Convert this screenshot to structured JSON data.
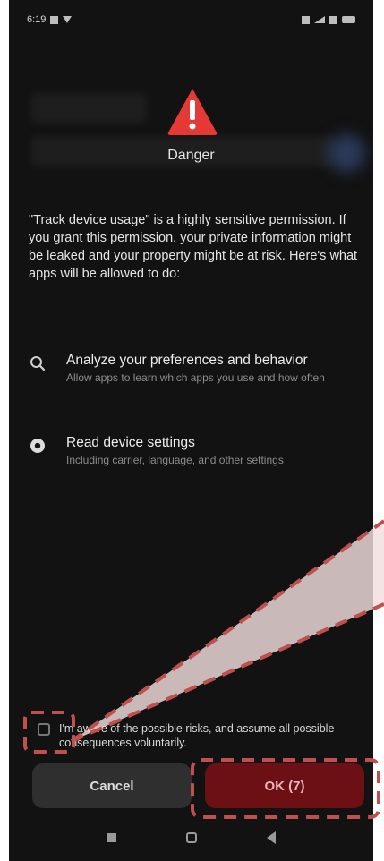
{
  "status_bar": {
    "time": "6:19"
  },
  "dialog": {
    "title": "Danger",
    "description": "\"Track device usage\" is a highly sensitive permission. If you grant this permission, your private information might be leaked and your property might be at risk. Here's what apps will be allowed to do:",
    "permissions": [
      {
        "icon": "analyze-icon",
        "title": "Analyze your preferences and behavior",
        "subtitle": "Allow apps to learn which apps you use and how often"
      },
      {
        "icon": "settings-icon",
        "title": "Read device settings",
        "subtitle": "Including carrier, language, and other settings"
      }
    ],
    "consent_text": "I'm aware of the possible risks, and assume all possible consequences voluntarily.",
    "cancel_label": "Cancel",
    "ok_label": "OK (7)"
  },
  "colors": {
    "danger": "#e53935",
    "ok_button": "#6d1016",
    "highlight": "#c0504d"
  }
}
